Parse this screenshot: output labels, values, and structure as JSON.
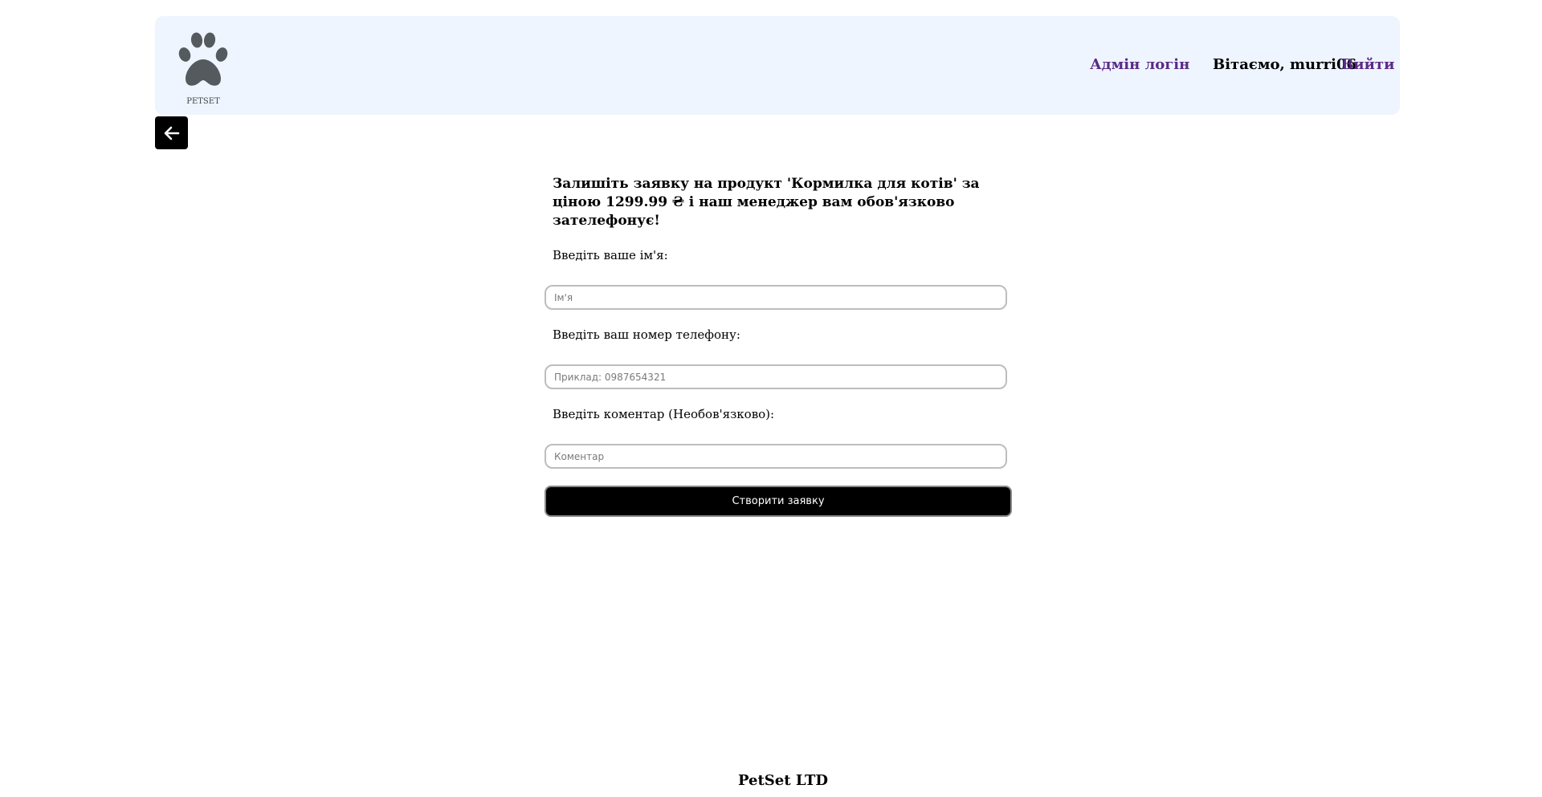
{
  "header": {
    "logo_text": "PETSET",
    "admin_login": "Адмін логін",
    "welcome": "Вітаємо, murri06",
    "logout": "Вийти"
  },
  "form": {
    "title": "Залишіть заявку на продукт 'Кормилка для котів' за ціною 1299.99 ₴ і наш менеджер вам обов'язково зателефонує!",
    "name_label": "Введіть ваше ім'я:",
    "name_placeholder": "Ім'я",
    "phone_label": "Введіть ваш номер телефону:",
    "phone_placeholder": "Приклад: 0987654321",
    "comment_label": "Введіть коментар (Необов'язково):",
    "comment_placeholder": "Коментар",
    "submit_label": "Створити заявку"
  },
  "footer": {
    "text": "PetSet LTD"
  },
  "colors": {
    "header_bg": "#eef5ff",
    "link": "#5b2a86",
    "button_bg": "#000000"
  },
  "icons": {
    "logo": "paw-icon",
    "back": "arrow-left-icon"
  }
}
